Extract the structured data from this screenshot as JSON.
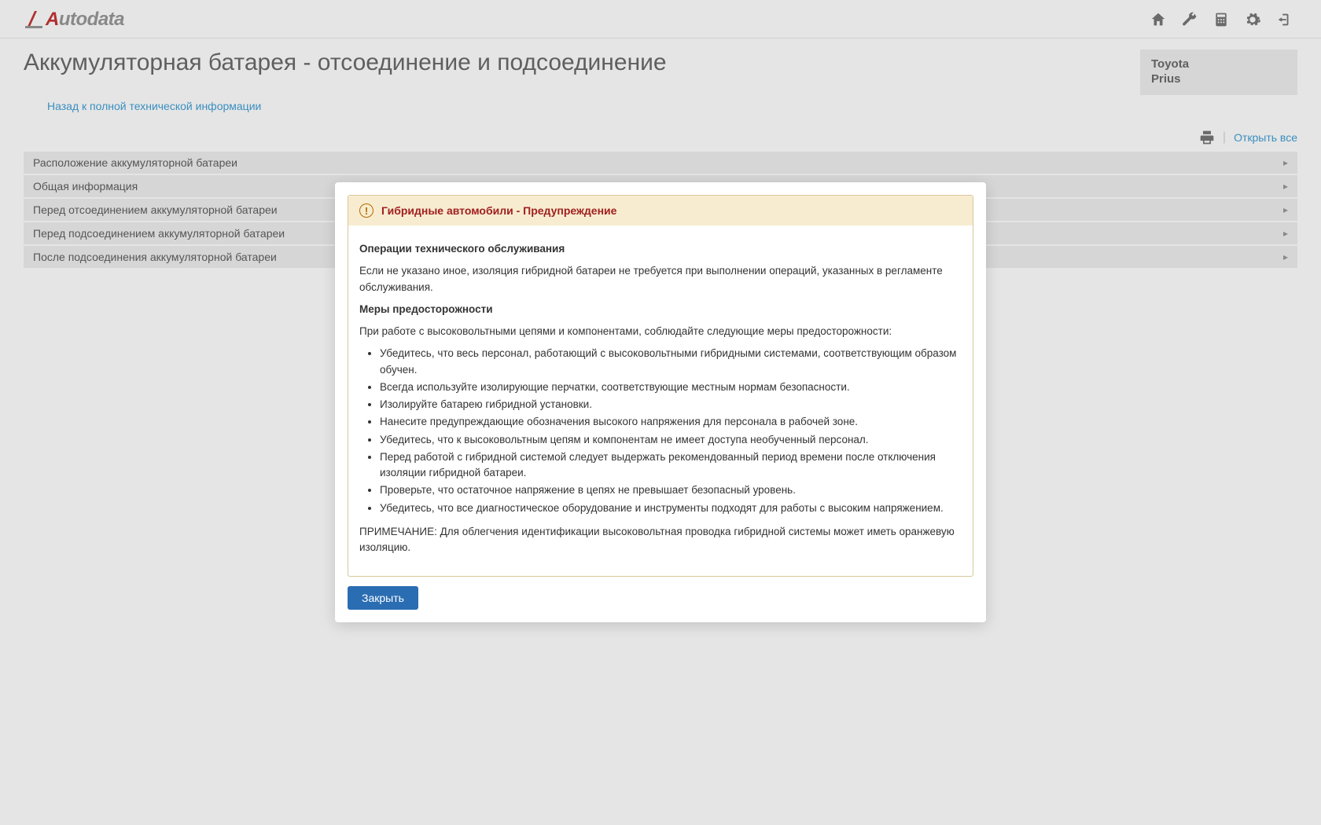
{
  "logo": {
    "brand_a": "A",
    "brand_rest": "utodata"
  },
  "page_title": "Аккумуляторная батарея - отсоединение и подсоединение",
  "vehicle": {
    "make": "Toyota",
    "model": "Prius"
  },
  "back_link": "Назад к полной технической информации",
  "toolbar": {
    "open_all": "Открыть все"
  },
  "sections": [
    {
      "label": "Расположение аккумуляторной батареи"
    },
    {
      "label": "Общая информация"
    },
    {
      "label": "Перед отсоединением аккумуляторной батареи"
    },
    {
      "label": "Перед подсоединением аккумуляторной батареи"
    },
    {
      "label": "После подсоединения аккумуляторной батареи"
    }
  ],
  "modal": {
    "warning_title": "Гибридные автомобили - Предупреждение",
    "h_ops": "Операции технического обслуживания",
    "p_ops": "Если не указано иное, изоляция гибридной батареи не требуется при выполнении операций, указанных в регламенте обслуживания.",
    "h_precaut": "Меры предосторожности",
    "p_precaut_intro": "При работе с высоковольтными цепями и компонентами, соблюдайте следующие меры предосторожности:",
    "bullets": [
      "Убедитесь, что весь персонал, работающий с высоковольтными гибридными системами, соответствующим образом обучен.",
      "Всегда используйте изолирующие перчатки, соответствующие местным нормам безопасности.",
      "Изолируйте батарею гибридной установки.",
      "Нанесите предупреждающие обозначения высокого напряжения для персонала в рабочей зоне.",
      "Убедитесь, что к высоковольтным цепям и компонентам не имеет доступа необученный персонал.",
      "Перед работой с гибридной системой следует выдержать рекомендованный период времени после отключения изоляции гибридной батареи.",
      "Проверьте, что остаточное напряжение в цепях не превышает безопасный уровень.",
      "Убедитесь, что все диагностическое оборудование и инструменты подходят для работы с высоким напряжением."
    ],
    "note": "ПРИМЕЧАНИЕ: Для облегчения идентификации высоковольтная проводка гибридной системы может иметь оранжевую изоляцию.",
    "close_label": "Закрыть"
  }
}
